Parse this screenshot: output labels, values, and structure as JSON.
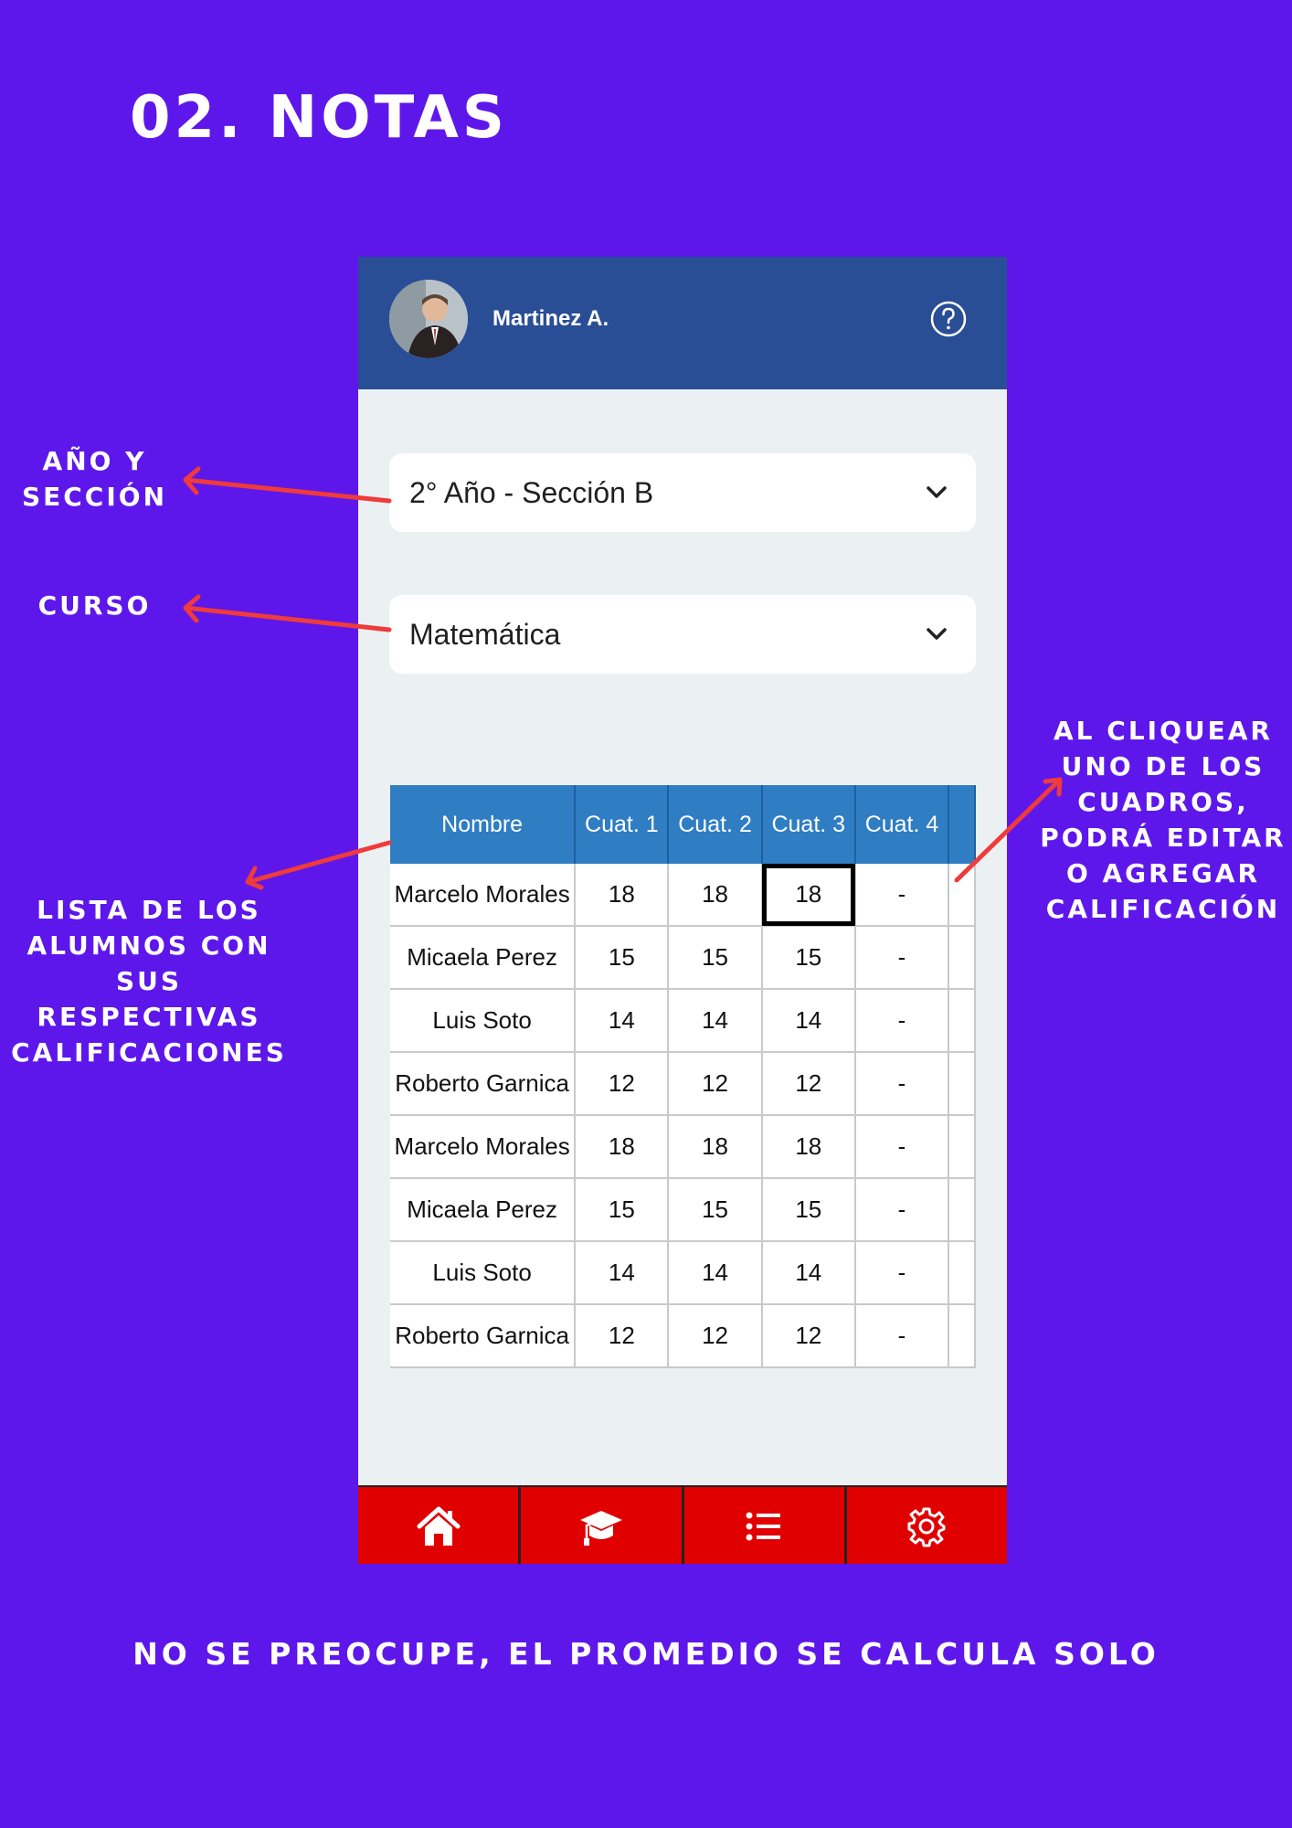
{
  "page": {
    "title": "02. NOTAS",
    "footer_note": "NO SE PREOCUPE, EL PROMEDIO SE CALCULA SOLO",
    "annotations": {
      "year_section": [
        "AÑO Y",
        "SECCIÓN"
      ],
      "course": [
        "CURSO"
      ],
      "student_list": [
        "LISTA DE LOS",
        "ALUMNOS CON",
        "SUS",
        "RESPECTIVAS",
        "CALIFICACIONES"
      ],
      "edit_hint": [
        "AL CLIQUEAR",
        "UNO DE LOS",
        "CUADROS,",
        "PODRÁ EDITAR",
        "O AGREGAR",
        "CALIFICACIÓN"
      ]
    },
    "colors": {
      "background": "#5e17eb",
      "arrow": "#ef3b3b"
    }
  },
  "app": {
    "header": {
      "user_name": "Martinez A.",
      "avatar": "teacher-photo",
      "help_icon": "question-circle-icon",
      "color": "#294e96"
    },
    "year_section_select": {
      "value": "2° Año - Sección B"
    },
    "course_select": {
      "value": "Matemática"
    },
    "grades_table": {
      "columns": [
        "Nombre",
        "Cuat. 1",
        "Cuat. 2",
        "Cuat. 3",
        "Cuat. 4"
      ],
      "rows": [
        [
          "Marcelo Morales",
          "18",
          "18",
          "18",
          "-"
        ],
        [
          "Micaela Perez",
          "15",
          "15",
          "15",
          "-"
        ],
        [
          "Luis Soto",
          "14",
          "14",
          "14",
          "-"
        ],
        [
          "Roberto Garnica",
          "12",
          "12",
          "12",
          "-"
        ],
        [
          "Marcelo Morales",
          "18",
          "18",
          "18",
          "-"
        ],
        [
          "Micaela Perez",
          "15",
          "15",
          "15",
          "-"
        ],
        [
          "Luis Soto",
          "14",
          "14",
          "14",
          "-"
        ],
        [
          "Roberto Garnica",
          "12",
          "12",
          "12",
          "-"
        ]
      ],
      "highlighted_cell": "Marcelo Morales, Cuat. 3"
    },
    "nav_bar": {
      "items": [
        "home-icon",
        "graduation-cap-icon",
        "list-icon",
        "gear-icon"
      ],
      "color": "#e00000"
    }
  }
}
